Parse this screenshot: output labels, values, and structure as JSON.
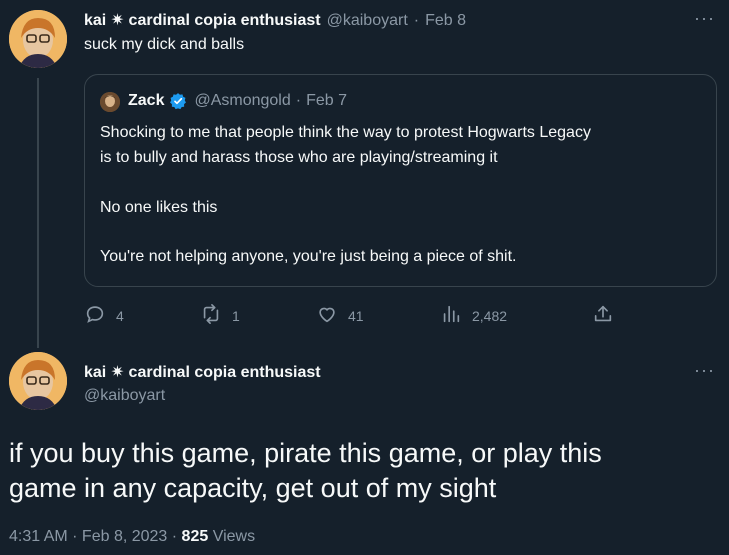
{
  "reply": {
    "display_name": "kai ✷ cardinal copia enthusiast",
    "handle": "@kaiboyart",
    "date": "Feb 8",
    "text": "suck my dick and balls",
    "more_icon": "more-icon"
  },
  "quoted": {
    "display_name": "Zack",
    "handle": "@Asmongold",
    "date": "Feb 7",
    "verified_color": "#1d9bf0",
    "line1": "Shocking to me that people think the way to protest Hogwarts Legacy",
    "line2": "is to bully and harass those who are playing/streaming it",
    "line3": "No one likes this",
    "line4": "You're not helping anyone, you're just being a piece of shit."
  },
  "actions": {
    "reply_count": "4",
    "retweet_count": "1",
    "like_count": "41",
    "views_count": "2,482"
  },
  "main": {
    "display_name": "kai ✷ cardinal copia enthusiast",
    "handle": "@kaiboyart",
    "text_line1": "if you buy this game, pirate this game, or play this",
    "text_line2": "game in any capacity, get out of my sight",
    "timestamp": "4:31 AM · Feb 8, 2023 · ",
    "views": "825",
    "views_label": " Views"
  },
  "colors": {
    "background": "#15202b",
    "text": "#f7f9f9",
    "muted": "#8b98a5",
    "border": "#38444d",
    "accent": "#1d9bf0"
  }
}
